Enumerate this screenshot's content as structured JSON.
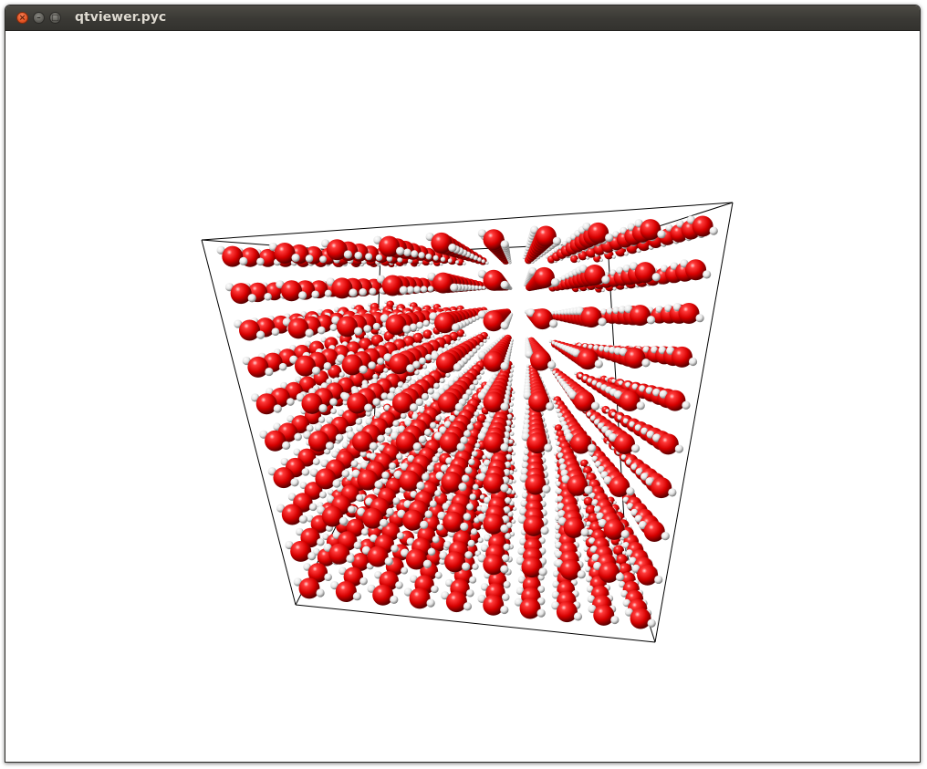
{
  "window": {
    "title": "qtviewer.pyc",
    "buttons": {
      "close_icon": "close-icon",
      "minimize_icon": "minimize-icon",
      "maximize_icon": "maximize-icon"
    }
  },
  "scene": {
    "background": "#ffffff",
    "box_color": "#000000",
    "oxygen_color": "#e00000",
    "hydrogen_color": "#f2f2f2",
    "molecules": "water"
  }
}
